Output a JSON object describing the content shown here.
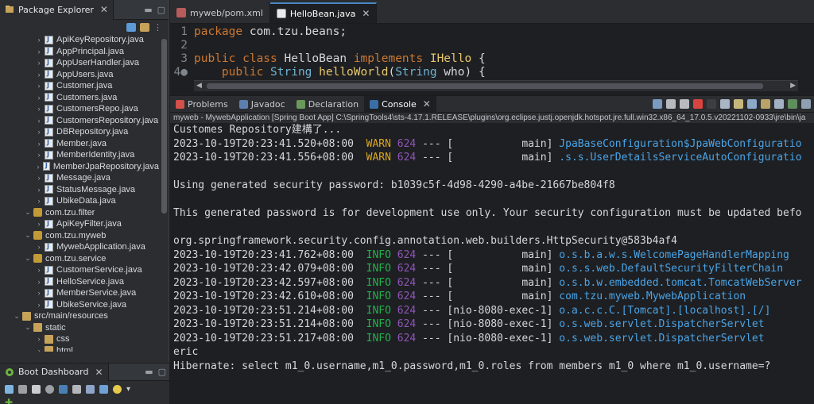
{
  "package_explorer": {
    "title": "Package Explorer",
    "items": [
      {
        "kind": "java",
        "label": "ApiKeyRepository.java"
      },
      {
        "kind": "java",
        "label": "AppPrincipal.java"
      },
      {
        "kind": "java",
        "label": "AppUserHandler.java"
      },
      {
        "kind": "java",
        "label": "AppUsers.java"
      },
      {
        "kind": "java",
        "label": "Customer.java"
      },
      {
        "kind": "java",
        "label": "Customers.java"
      },
      {
        "kind": "java",
        "label": "CustomersRepo.java"
      },
      {
        "kind": "java",
        "label": "CustomersRepository.java"
      },
      {
        "kind": "java",
        "label": "DBRepository.java"
      },
      {
        "kind": "java",
        "label": "Member.java"
      },
      {
        "kind": "java",
        "label": "MemberIdentity.java"
      },
      {
        "kind": "java",
        "label": "MemberJpaRepository.java"
      },
      {
        "kind": "java",
        "label": "Message.java"
      },
      {
        "kind": "java",
        "label": "StatusMessage.java"
      },
      {
        "kind": "java",
        "label": "UbikeData.java"
      },
      {
        "kind": "package",
        "label": "com.tzu.filter"
      },
      {
        "kind": "java2",
        "label": "ApiKeyFilter.java"
      },
      {
        "kind": "package",
        "label": "com.tzu.myweb"
      },
      {
        "kind": "java2",
        "label": "MywebApplication.java"
      },
      {
        "kind": "package",
        "label": "com.tzu.service"
      },
      {
        "kind": "java2",
        "label": "CustomerService.java"
      },
      {
        "kind": "java2",
        "label": "HelloService.java"
      },
      {
        "kind": "java2",
        "label": "MemberService.java"
      },
      {
        "kind": "java2",
        "label": "UbikeService.java"
      },
      {
        "kind": "src",
        "label": "src/main/resources"
      },
      {
        "kind": "folder",
        "label": "static"
      },
      {
        "kind": "folder2",
        "label": "css"
      },
      {
        "kind": "folder2",
        "label": "html"
      }
    ]
  },
  "boot_dashboard": {
    "title": "Boot Dashboard"
  },
  "editor": {
    "tabs": [
      {
        "label": "myweb/pom.xml",
        "active": false
      },
      {
        "label": "HelloBean.java",
        "active": true
      }
    ],
    "lines": [
      {
        "n": "1",
        "parts": [
          [
            "kw",
            "package "
          ],
          [
            "pl",
            "com.tzu.beans;"
          ]
        ]
      },
      {
        "n": "2",
        "parts": []
      },
      {
        "n": "3",
        "parts": [
          [
            "kw",
            "public class "
          ],
          [
            "pl",
            "HelloBean "
          ],
          [
            "kw",
            "implements "
          ],
          [
            "fn",
            "IHello"
          ],
          [
            "pl",
            " {"
          ]
        ]
      },
      {
        "n": "4●",
        "parts": [
          [
            "pl",
            "    "
          ],
          [
            "kw",
            "public "
          ],
          [
            "ty",
            "String "
          ],
          [
            "fn",
            "helloWorld"
          ],
          [
            "pl",
            "("
          ],
          [
            "ty",
            "String "
          ],
          [
            "pl",
            "who) {"
          ]
        ]
      }
    ]
  },
  "console": {
    "tabs": [
      "Problems",
      "Javadoc",
      "Declaration",
      "Console"
    ],
    "active_tab": "Console",
    "path": "myweb - MywebApplication [Spring Boot App] C:\\SpringTools4\\sts-4.17.1.RELEASE\\plugins\\org.eclipse.justj.openjdk.hotspot.jre.full.win32.x86_64_17.0.5.v20221102-0933\\jre\\bin\\ja",
    "lines": [
      {
        "t": "plain",
        "text": "Customes Repository建構了..."
      },
      {
        "t": "log",
        "ts": "2023-10-19T20:23:41.520+08:00",
        "level": "WARN",
        "pid": "624",
        "thread": "[           main]",
        "logger": "JpaBaseConfiguration$JpaWebConfiguratio"
      },
      {
        "t": "log",
        "ts": "2023-10-19T20:23:41.556+08:00",
        "level": "WARN",
        "pid": "624",
        "thread": "[           main]",
        "logger": ".s.s.UserDetailsServiceAutoConfiguratio"
      },
      {
        "t": "plain",
        "text": ""
      },
      {
        "t": "plain",
        "text": "Using generated security password: b1039c5f-4d98-4290-a4be-21667be804f8"
      },
      {
        "t": "plain",
        "text": ""
      },
      {
        "t": "plain",
        "text": "This generated password is for development use only. Your security configuration must be updated befo"
      },
      {
        "t": "plain",
        "text": ""
      },
      {
        "t": "plain",
        "text": "org.springframework.security.config.annotation.web.builders.HttpSecurity@583b4af4"
      },
      {
        "t": "log",
        "ts": "2023-10-19T20:23:41.762+08:00",
        "level": "INFO",
        "pid": "624",
        "thread": "[           main]",
        "logger": "o.s.b.a.w.s.WelcomePageHandlerMapping"
      },
      {
        "t": "log",
        "ts": "2023-10-19T20:23:42.079+08:00",
        "level": "INFO",
        "pid": "624",
        "thread": "[           main]",
        "logger": "o.s.s.web.DefaultSecurityFilterChain"
      },
      {
        "t": "log",
        "ts": "2023-10-19T20:23:42.597+08:00",
        "level": "INFO",
        "pid": "624",
        "thread": "[           main]",
        "logger": "o.s.b.w.embedded.tomcat.TomcatWebServer"
      },
      {
        "t": "log",
        "ts": "2023-10-19T20:23:42.610+08:00",
        "level": "INFO",
        "pid": "624",
        "thread": "[           main]",
        "logger": "com.tzu.myweb.MywebApplication"
      },
      {
        "t": "log",
        "ts": "2023-10-19T20:23:51.214+08:00",
        "level": "INFO",
        "pid": "624",
        "thread": "[nio-8080-exec-1]",
        "logger": "o.a.c.c.C.[Tomcat].[localhost].[/]"
      },
      {
        "t": "log",
        "ts": "2023-10-19T20:23:51.214+08:00",
        "level": "INFO",
        "pid": "624",
        "thread": "[nio-8080-exec-1]",
        "logger": "o.s.web.servlet.DispatcherServlet"
      },
      {
        "t": "log",
        "ts": "2023-10-19T20:23:51.217+08:00",
        "level": "INFO",
        "pid": "624",
        "thread": "[nio-8080-exec-1]",
        "logger": "o.s.web.servlet.DispatcherServlet"
      },
      {
        "t": "plain",
        "text": "eric"
      },
      {
        "t": "plain",
        "text": "Hibernate: select m1_0.username,m1_0.password,m1_0.roles from members m1_0 where m1_0.username=?"
      }
    ]
  }
}
